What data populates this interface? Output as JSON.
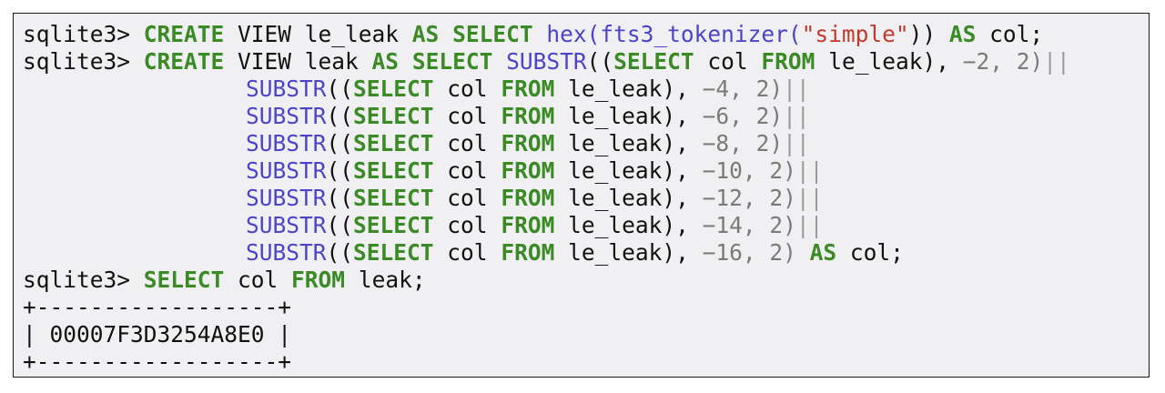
{
  "terminal": {
    "lines": [
      [
        {
          "t": "sqlite3> ",
          "c": "prompt"
        },
        {
          "t": "CREATE",
          "c": "kw"
        },
        {
          "t": " VIEW le_leak ",
          "c": "plain"
        },
        {
          "t": "AS",
          "c": "kw"
        },
        {
          "t": " ",
          "c": "plain"
        },
        {
          "t": "SELECT",
          "c": "kw"
        },
        {
          "t": " ",
          "c": "plain"
        },
        {
          "t": "hex(fts3_tokenizer(",
          "c": "fn"
        },
        {
          "t": "\"simple\"",
          "c": "str"
        },
        {
          "t": ")) ",
          "c": "plain"
        },
        {
          "t": "AS",
          "c": "kw"
        },
        {
          "t": " col;",
          "c": "plain"
        }
      ],
      [
        {
          "t": "sqlite3> ",
          "c": "prompt"
        },
        {
          "t": "CREATE",
          "c": "kw"
        },
        {
          "t": " VIEW leak ",
          "c": "plain"
        },
        {
          "t": "AS",
          "c": "kw"
        },
        {
          "t": " ",
          "c": "plain"
        },
        {
          "t": "SELECT",
          "c": "kw"
        },
        {
          "t": " ",
          "c": "plain"
        },
        {
          "t": "SUBSTR",
          "c": "fn"
        },
        {
          "t": "((",
          "c": "plain"
        },
        {
          "t": "SELECT",
          "c": "kw"
        },
        {
          "t": " col ",
          "c": "plain"
        },
        {
          "t": "FROM",
          "c": "kw"
        },
        {
          "t": " le_leak), ",
          "c": "plain"
        },
        {
          "t": "−2, 2)",
          "c": "num"
        },
        {
          "t": "||",
          "c": "op"
        }
      ],
      [
        {
          "indent": true
        },
        {
          "t": "SUBSTR",
          "c": "fn"
        },
        {
          "t": "((",
          "c": "plain"
        },
        {
          "t": "SELECT",
          "c": "kw"
        },
        {
          "t": " col ",
          "c": "plain"
        },
        {
          "t": "FROM",
          "c": "kw"
        },
        {
          "t": " le_leak), ",
          "c": "plain"
        },
        {
          "t": "−4, 2)",
          "c": "num"
        },
        {
          "t": "||",
          "c": "op"
        }
      ],
      [
        {
          "indent": true
        },
        {
          "t": "SUBSTR",
          "c": "fn"
        },
        {
          "t": "((",
          "c": "plain"
        },
        {
          "t": "SELECT",
          "c": "kw"
        },
        {
          "t": " col ",
          "c": "plain"
        },
        {
          "t": "FROM",
          "c": "kw"
        },
        {
          "t": " le_leak), ",
          "c": "plain"
        },
        {
          "t": "−6, 2)",
          "c": "num"
        },
        {
          "t": "||",
          "c": "op"
        }
      ],
      [
        {
          "indent": true
        },
        {
          "t": "SUBSTR",
          "c": "fn"
        },
        {
          "t": "((",
          "c": "plain"
        },
        {
          "t": "SELECT",
          "c": "kw"
        },
        {
          "t": " col ",
          "c": "plain"
        },
        {
          "t": "FROM",
          "c": "kw"
        },
        {
          "t": " le_leak), ",
          "c": "plain"
        },
        {
          "t": "−8, 2)",
          "c": "num"
        },
        {
          "t": "||",
          "c": "op"
        }
      ],
      [
        {
          "indent": true
        },
        {
          "t": "SUBSTR",
          "c": "fn"
        },
        {
          "t": "((",
          "c": "plain"
        },
        {
          "t": "SELECT",
          "c": "kw"
        },
        {
          "t": " col ",
          "c": "plain"
        },
        {
          "t": "FROM",
          "c": "kw"
        },
        {
          "t": " le_leak), ",
          "c": "plain"
        },
        {
          "t": "−10, 2)",
          "c": "num"
        },
        {
          "t": "||",
          "c": "op"
        }
      ],
      [
        {
          "indent": true
        },
        {
          "t": "SUBSTR",
          "c": "fn"
        },
        {
          "t": "((",
          "c": "plain"
        },
        {
          "t": "SELECT",
          "c": "kw"
        },
        {
          "t": " col ",
          "c": "plain"
        },
        {
          "t": "FROM",
          "c": "kw"
        },
        {
          "t": " le_leak), ",
          "c": "plain"
        },
        {
          "t": "−12, 2)",
          "c": "num"
        },
        {
          "t": "||",
          "c": "op"
        }
      ],
      [
        {
          "indent": true
        },
        {
          "t": "SUBSTR",
          "c": "fn"
        },
        {
          "t": "((",
          "c": "plain"
        },
        {
          "t": "SELECT",
          "c": "kw"
        },
        {
          "t": " col ",
          "c": "plain"
        },
        {
          "t": "FROM",
          "c": "kw"
        },
        {
          "t": " le_leak), ",
          "c": "plain"
        },
        {
          "t": "−14, 2)",
          "c": "num"
        },
        {
          "t": "||",
          "c": "op"
        }
      ],
      [
        {
          "indent": true
        },
        {
          "t": "SUBSTR",
          "c": "fn"
        },
        {
          "t": "((",
          "c": "plain"
        },
        {
          "t": "SELECT",
          "c": "kw"
        },
        {
          "t": " col ",
          "c": "plain"
        },
        {
          "t": "FROM",
          "c": "kw"
        },
        {
          "t": " le_leak), ",
          "c": "plain"
        },
        {
          "t": "−16, 2)",
          "c": "num"
        },
        {
          "t": " ",
          "c": "plain"
        },
        {
          "t": "AS",
          "c": "kw"
        },
        {
          "t": " col;",
          "c": "plain"
        }
      ],
      [
        {
          "t": "sqlite3> ",
          "c": "prompt"
        },
        {
          "t": "SELECT",
          "c": "kw"
        },
        {
          "t": " col ",
          "c": "plain"
        },
        {
          "t": "FROM",
          "c": "kw"
        },
        {
          "t": " leak;",
          "c": "plain"
        }
      ],
      [
        {
          "t": "+------------------+",
          "c": "plain"
        }
      ],
      [
        {
          "t": "| 00007F3D3254A8E0 |",
          "c": "plain"
        }
      ],
      [
        {
          "t": "+------------------+",
          "c": "plain"
        }
      ]
    ]
  }
}
